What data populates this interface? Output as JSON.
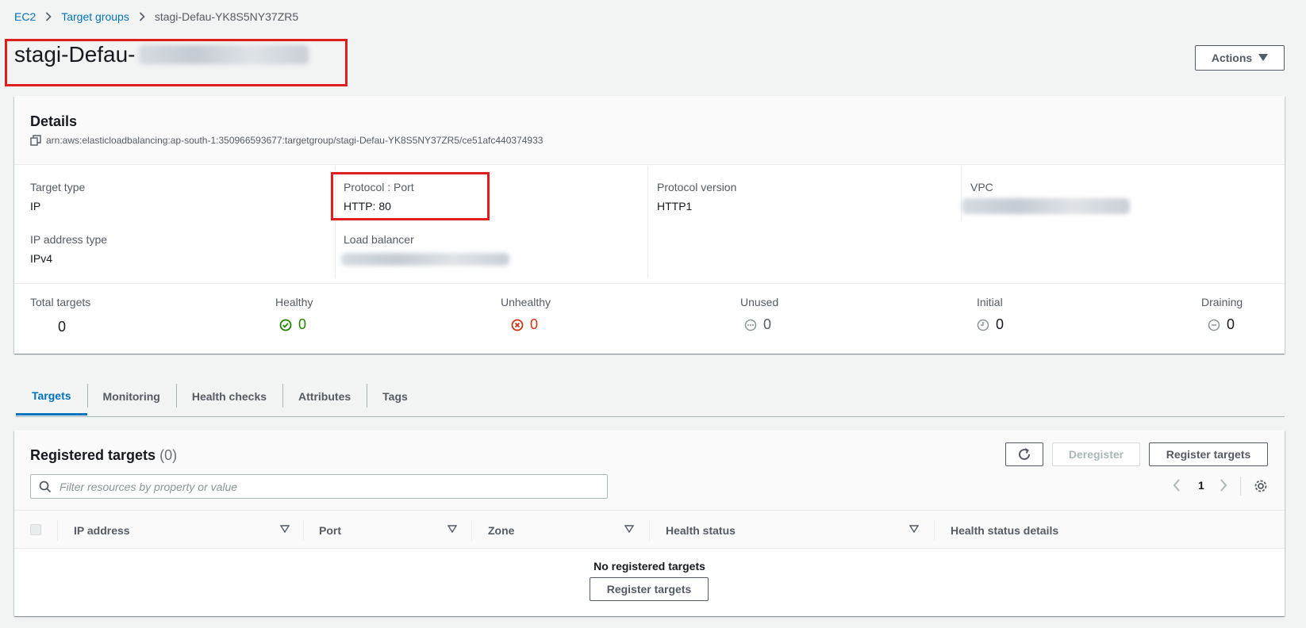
{
  "breadcrumb": {
    "items": [
      "EC2",
      "Target groups"
    ],
    "current": "stagi-Defau-YK8S5NY37ZR5"
  },
  "page": {
    "title": "stagi-Defau-",
    "actions_label": "Actions"
  },
  "details": {
    "heading": "Details",
    "arn": "arn:aws:elasticloadbalancing:ap-south-1:350966593677:targetgroup/stagi-Defau-YK8S5NY37ZR5/ce51afc440374933",
    "target_type_label": "Target type",
    "target_type_value": "IP",
    "protocol_port_label": "Protocol : Port",
    "protocol_port_value": "HTTP: 80",
    "protocol_version_label": "Protocol version",
    "protocol_version_value": "HTTP1",
    "vpc_label": "VPC",
    "ip_address_type_label": "IP address type",
    "ip_address_type_value": "IPv4",
    "load_balancer_label": "Load balancer"
  },
  "counts": {
    "total_label": "Total targets",
    "total_value": "0",
    "healthy_label": "Healthy",
    "healthy_value": "0",
    "unhealthy_label": "Unhealthy",
    "unhealthy_value": "0",
    "unused_label": "Unused",
    "unused_value": "0",
    "initial_label": "Initial",
    "initial_value": "0",
    "draining_label": "Draining",
    "draining_value": "0"
  },
  "tabs": [
    {
      "label": "Targets"
    },
    {
      "label": "Monitoring"
    },
    {
      "label": "Health checks"
    },
    {
      "label": "Attributes"
    },
    {
      "label": "Tags"
    }
  ],
  "targets": {
    "title": "Registered targets",
    "count": "(0)",
    "deregister_label": "Deregister",
    "register_label": "Register targets",
    "search_placeholder": "Filter resources by property or value",
    "page_number": "1",
    "columns": [
      "IP address",
      "Port",
      "Zone",
      "Health status",
      "Health status details"
    ],
    "empty_title": "No registered targets",
    "empty_button": "Register targets"
  },
  "colors": {
    "link": "#0073bb",
    "healthy": "#1d8102",
    "unhealthy": "#d13212",
    "highlight": "#e01e1e"
  }
}
